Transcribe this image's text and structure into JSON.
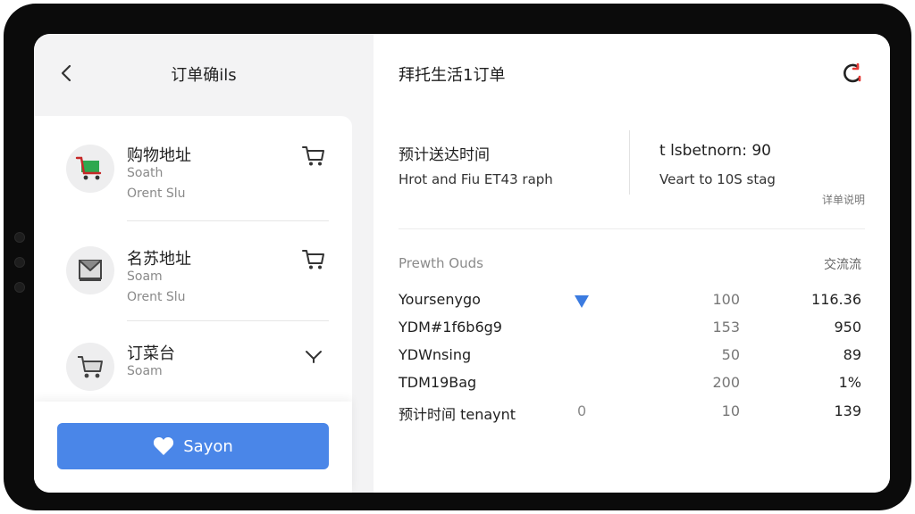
{
  "left_panel": {
    "title": "订单确ils",
    "items": [
      {
        "title": "购物地址",
        "line1": "Soath",
        "line2": "Orent Slu",
        "icon": "cart-icon"
      },
      {
        "title": "名苏地址",
        "line1": "Soam",
        "line2": "Orent Slu",
        "icon": "package-icon"
      },
      {
        "title": "订菜台",
        "line1": "Soam",
        "line2": "",
        "icon": "cart-icon"
      }
    ],
    "primary_button": {
      "label": "Sayon",
      "icon": "heart-icon"
    }
  },
  "right_panel": {
    "title": "拜托生活1订单",
    "info": {
      "label": "预计送达时间",
      "sub": "Hrot and Fiu ET43 raph",
      "right_label": "t lsbetnorn: 90",
      "right_sub": "Veart to 10S stag",
      "link": "详单说明"
    },
    "table": {
      "header": "Prewth Ouds",
      "header_right": "交流流",
      "rows": [
        {
          "name": "Yoursenygo",
          "extra": "",
          "mid": "100",
          "last": "116.36"
        },
        {
          "name": "YDM#1f6b6g9",
          "extra": "",
          "mid": "153",
          "last": "950"
        },
        {
          "name": "YDWnsing",
          "extra": "",
          "mid": "50",
          "last": "89"
        },
        {
          "name": "TDM19Bag",
          "extra": "",
          "mid": "200",
          "last": "1%"
        },
        {
          "name": "预计时间 tenaynt",
          "extra": "0",
          "mid": "10",
          "last": "139"
        }
      ]
    }
  },
  "colors": {
    "accent": "#4a86e8",
    "cart_green": "#2fa84f",
    "sort_blue": "#3b7be0",
    "refresh_red": "#e53935"
  }
}
